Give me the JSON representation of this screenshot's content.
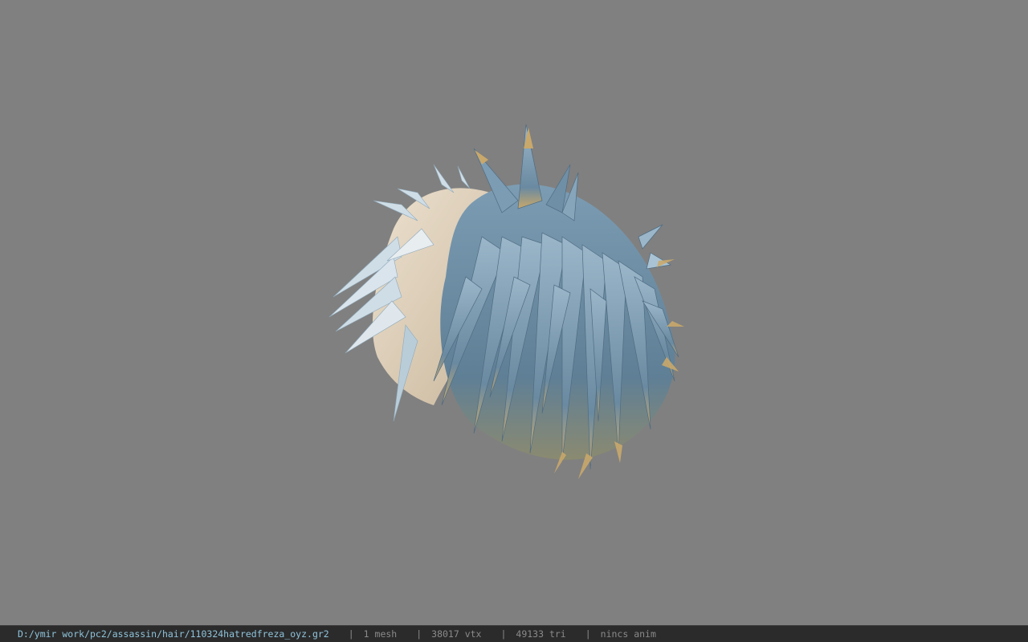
{
  "viewport": {
    "background": "#808080",
    "model": {
      "icon": "hair-mesh-model",
      "colors": {
        "blonde": "#e2d3bd",
        "blonde_shade": "#bfae96",
        "blue": "#6f8fa6",
        "blue_light": "#a9c3d4",
        "blue_dark": "#4f6c82",
        "tip_gold": "#c9a86b"
      }
    }
  },
  "status_bar": {
    "file_path": "D:/ymir work/pc2/assassin/hair/110324hatredfreza_oyz.gr2",
    "separator": "|",
    "mesh_count": "1 mesh",
    "vertex_count": "38017 vtx",
    "triangle_count": "49133 tri",
    "anim_status": "nincs anim"
  }
}
